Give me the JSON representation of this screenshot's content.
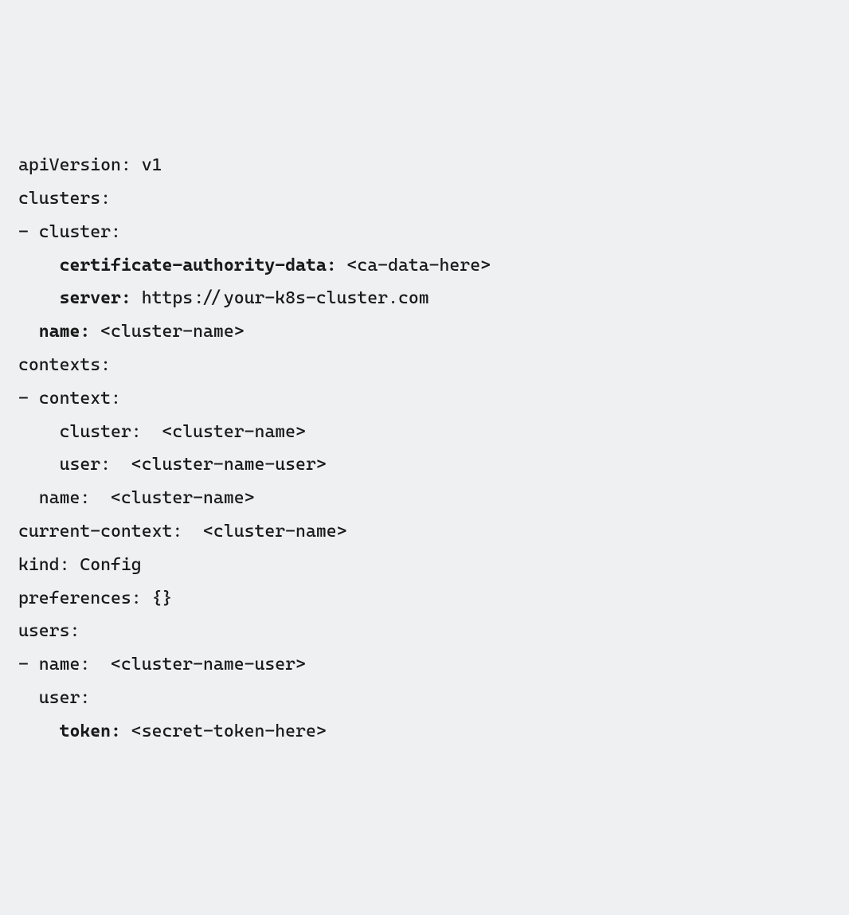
{
  "code": {
    "line1_key": "apiVersion:",
    "line1_val": " v1",
    "line2": "clusters:",
    "line3": "- cluster:",
    "line4_indent": "    ",
    "line4_key": "certificate-authority-data:",
    "line4_val": " <ca-data-here>",
    "line5_indent": "    ",
    "line5_key": "server:",
    "line5_val": " https://your-k8s-cluster.com",
    "line6_indent": "  ",
    "line6_key": "name:",
    "line6_val": " <cluster-name>",
    "line7": "contexts:",
    "line8": "- context:",
    "line9": "    cluster:  <cluster-name>",
    "line10": "    user:  <cluster-name-user>",
    "line11": "  name:  <cluster-name>",
    "line12": "current-context:  <cluster-name>",
    "line13": "kind: Config",
    "line14": "preferences: {}",
    "line15": "users:",
    "line16": "- name:  <cluster-name-user>",
    "line17": "  user:",
    "line18_indent": "    ",
    "line18_key": "token:",
    "line18_val": " <secret-token-here>"
  }
}
